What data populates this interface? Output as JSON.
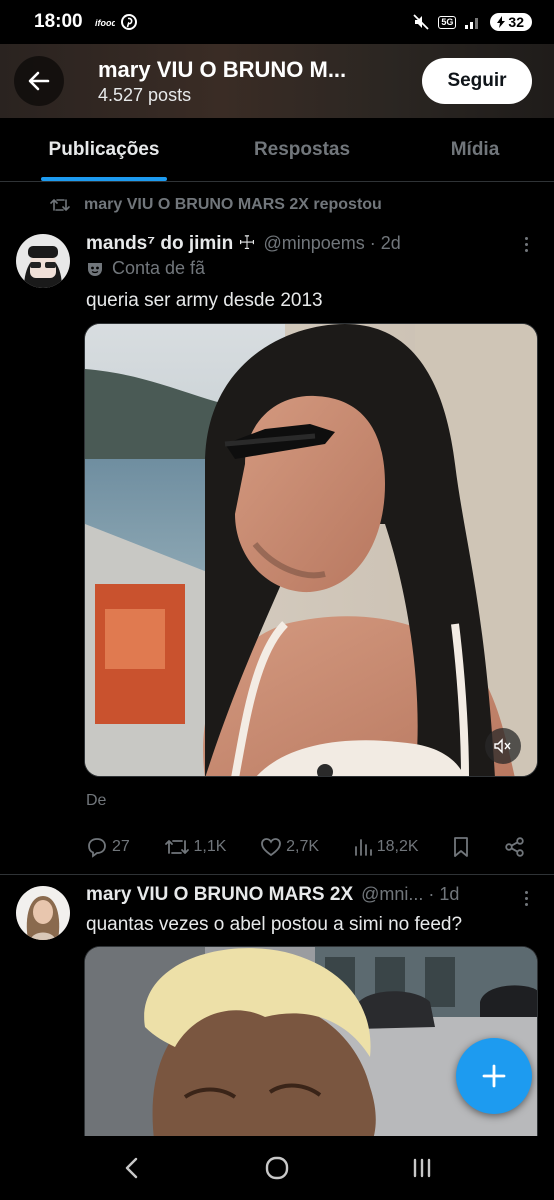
{
  "status_bar": {
    "time": "18:00",
    "network": "5G",
    "battery": "32"
  },
  "header": {
    "title": "mary VIU O BRUNO M...",
    "posts_count": "4.527 posts",
    "follow_label": "Seguir"
  },
  "tabs": [
    {
      "label": "Publicações",
      "active": true
    },
    {
      "label": "Respostas",
      "active": false
    },
    {
      "label": "Mídia",
      "active": false
    }
  ],
  "post1": {
    "repost_text": "mary VIU O BRUNO MARS 2X repostou",
    "author_name": "mands⁷ do jimin ☩",
    "handle_time": "@minpoems · 2d",
    "fan_label": "Conta de fã",
    "text": "queria ser army desde 2013",
    "from_label": "De",
    "replies": "27",
    "reposts": "1,1K",
    "likes": "2,7K",
    "views": "18,2K"
  },
  "post2": {
    "author_name": "mary VIU O BRUNO MARS 2X",
    "handle_time": "@mni... · 1d",
    "text": "quantas vezes o abel postou a simi no feed?"
  },
  "colors": {
    "accent": "#1d9bf0",
    "background": "#000000",
    "muted": "#71767b"
  }
}
